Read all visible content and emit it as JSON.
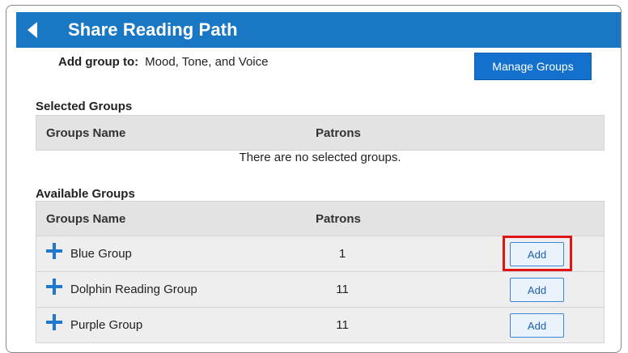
{
  "header": {
    "title": "Share Reading Path"
  },
  "add_group_to": {
    "label": "Add group to:",
    "value": "Mood, Tone, and Voice"
  },
  "manage_groups_label": "Manage Groups",
  "selected_groups": {
    "section_label": "Selected Groups",
    "columns": [
      "Groups Name",
      "Patrons"
    ],
    "empty_message": "There are no selected groups."
  },
  "available_groups": {
    "section_label": "Available Groups",
    "columns": [
      "Groups Name",
      "Patrons"
    ],
    "rows": [
      {
        "name": "Blue Group",
        "patrons": "1",
        "action": "Add",
        "highlighted": true
      },
      {
        "name": "Dolphin Reading Group",
        "patrons": "11",
        "action": "Add",
        "highlighted": false
      },
      {
        "name": "Purple Group",
        "patrons": "11",
        "action": "Add",
        "highlighted": false
      }
    ]
  },
  "colors": {
    "title_bar": "#1a77c4",
    "primary_button": "#1370cc",
    "plus_icon": "#1f78cf",
    "highlight_box": "#e01414"
  }
}
